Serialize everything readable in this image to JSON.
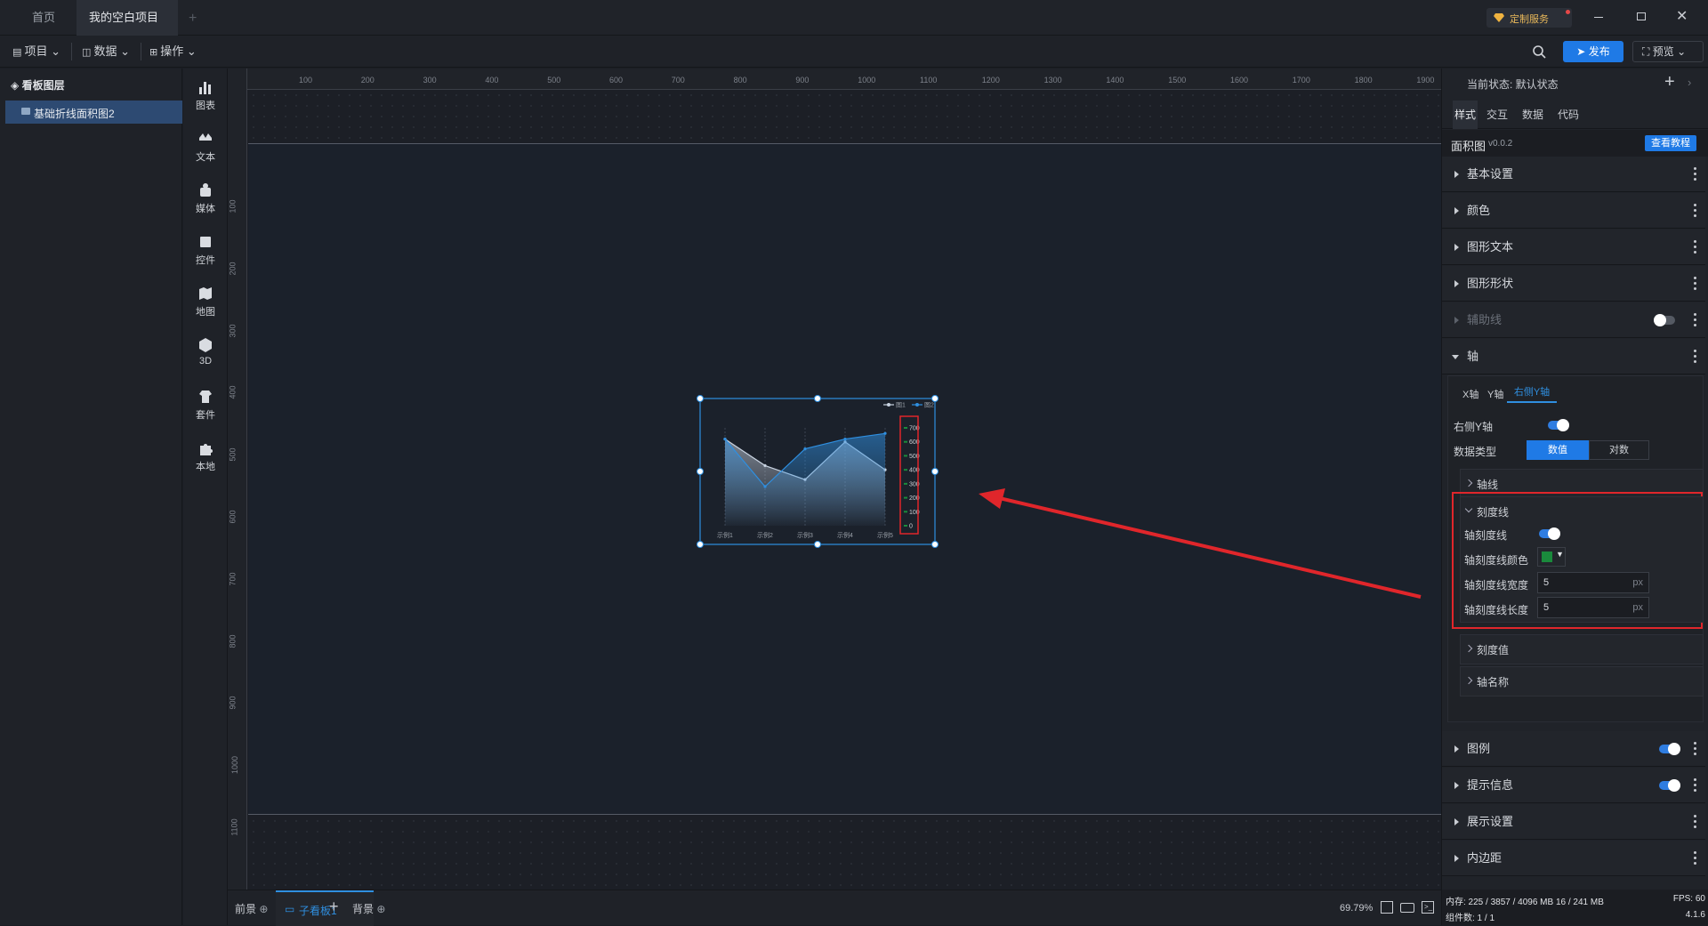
{
  "titlebar": {
    "tabs": [
      {
        "label": "首页"
      },
      {
        "label": "我的空白项目"
      }
    ],
    "custom_service": "定制服务"
  },
  "menubar": {
    "project": "项目",
    "data": "数据",
    "operate": "操作",
    "publish": "发布",
    "preview": "预览"
  },
  "layers": {
    "title": "看板图层",
    "items": [
      {
        "label": "基础折线面积图2"
      }
    ]
  },
  "toolbox": [
    {
      "label": "图表",
      "icon": "bar-chart-icon"
    },
    {
      "label": "文本",
      "icon": "text-icon"
    },
    {
      "label": "媒体",
      "icon": "media-icon"
    },
    {
      "label": "控件",
      "icon": "widget-icon"
    },
    {
      "label": "地图",
      "icon": "map-icon"
    },
    {
      "label": "3D",
      "icon": "cube-icon"
    },
    {
      "label": "套件",
      "icon": "kit-icon"
    },
    {
      "label": "本地",
      "icon": "puzzle-icon"
    }
  ],
  "ruler": {
    "top_ticks": [
      "100",
      "200",
      "300",
      "400",
      "500",
      "600",
      "700",
      "800",
      "900",
      "1000",
      "1100",
      "1200",
      "1300",
      "1400",
      "1500",
      "1600",
      "1700",
      "1800",
      "1900"
    ],
    "left_ticks": [
      "100",
      "200",
      "300",
      "400",
      "500",
      "600",
      "700",
      "800",
      "900",
      "1000",
      "1100"
    ]
  },
  "chart_data": {
    "type": "area",
    "categories": [
      "示例1",
      "示例2",
      "示例3",
      "示例4",
      "示例5"
    ],
    "series": [
      {
        "name": "图1",
        "values": [
          620,
          430,
          330,
          600,
          400
        ],
        "color": "#c9d4e2"
      },
      {
        "name": "图2",
        "values": [
          620,
          280,
          550,
          620,
          660
        ],
        "color": "#2f8fe0"
      }
    ],
    "right_y_ticks": [
      "700",
      "600",
      "500",
      "400",
      "300",
      "200",
      "100",
      "0"
    ],
    "ylim": [
      0,
      700
    ],
    "legend_position": "top-right",
    "highlight_color": "#e0262b"
  },
  "bottombar": {
    "front": "前景",
    "subboard": "子看板1",
    "background": "背景",
    "zoom": "69.79%"
  },
  "right": {
    "state_label": "当前状态: 默认状态",
    "tabs": [
      "样式",
      "交互",
      "数据",
      "代码"
    ],
    "component_name": "面积图",
    "version": "v0.0.2",
    "tutorial": "查看教程",
    "sections_top": [
      "基本设置",
      "颜色",
      "图形文本",
      "图形形状",
      "辅助线"
    ],
    "axis_section": "轴",
    "axis_tabs": [
      "X轴",
      "Y轴",
      "右侧Y轴"
    ],
    "right_y_label": "右侧Y轴",
    "data_type_label": "数据类型",
    "data_type_options": [
      "数值",
      "对数"
    ],
    "axis_line": "轴线",
    "tick_line": "刻度线",
    "tick_fields": {
      "tick_line_label": "轴刻度线",
      "tick_color_label": "轴刻度线颜色",
      "tick_color": "#1a8a3c",
      "tick_width_label": "轴刻度线宽度",
      "tick_width": "5",
      "tick_length_label": "轴刻度线长度",
      "tick_length": "5",
      "unit": "px"
    },
    "tick_value": "刻度值",
    "axis_name": "轴名称",
    "sections_bottom": [
      "图例",
      "提示信息",
      "展示设置",
      "内边距"
    ],
    "status": {
      "memory": "内存: 225 / 3857 / 4096 MB 16 / 241 MB",
      "fps": "FPS: 60",
      "components": "组件数: 1 / 1",
      "app_version": "4.1.6"
    }
  }
}
